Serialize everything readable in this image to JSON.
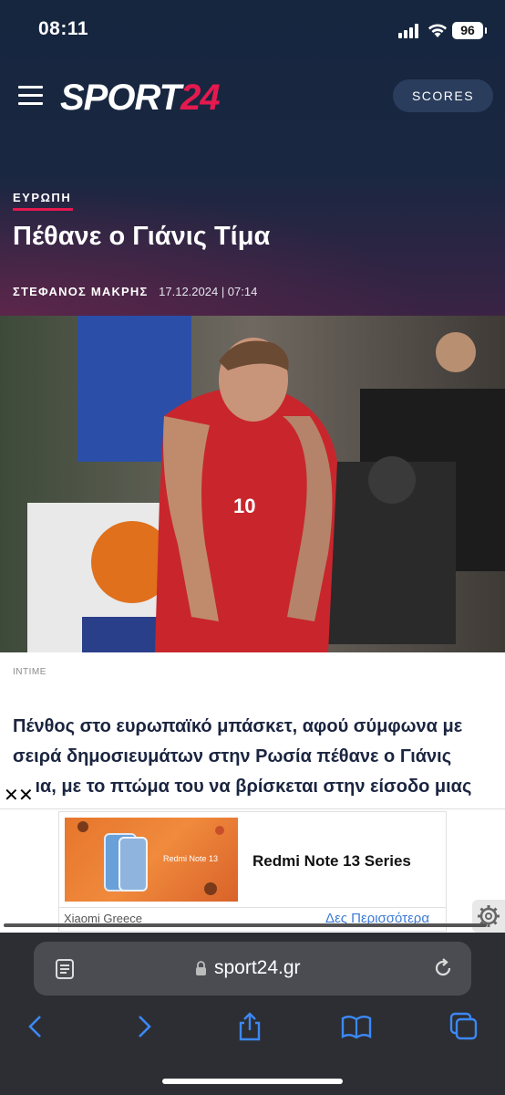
{
  "status_bar": {
    "time": "08:11",
    "battery": "96"
  },
  "header": {
    "logo_main": "SPORT",
    "logo_accent": "24",
    "scores_label": "SCORES"
  },
  "article": {
    "category": "ΕΥΡΩΠΗ",
    "title": "Πέθανε ο Γιάνις Τίμα",
    "author": "ΣΤΕΦΑΝΟΣ ΜΑΚΡΗΣ",
    "date": "17.12.2024 | 07:14",
    "photo_credit": "INTIME",
    "photo_jersey_number": "10",
    "body_lines": [
      "Πένθος στο ευρωπαϊκό μπάσκετ, αφού σύμφωνα με",
      "σειρά δημοσιευμάτων στην Ρωσία πέθανε ο Γιάνις",
      "Τίμα, με το πτώμα του να βρίσκεται στην είσοδο μιας"
    ]
  },
  "ad": {
    "close_label": "✕✕",
    "title": "Redmi Note 13 Series",
    "brand": "Xiaomi Greece",
    "more_label": "Δες Περισσότερα",
    "image_text": "Redmi Note 13"
  },
  "browser": {
    "url": "sport24.gr"
  }
}
